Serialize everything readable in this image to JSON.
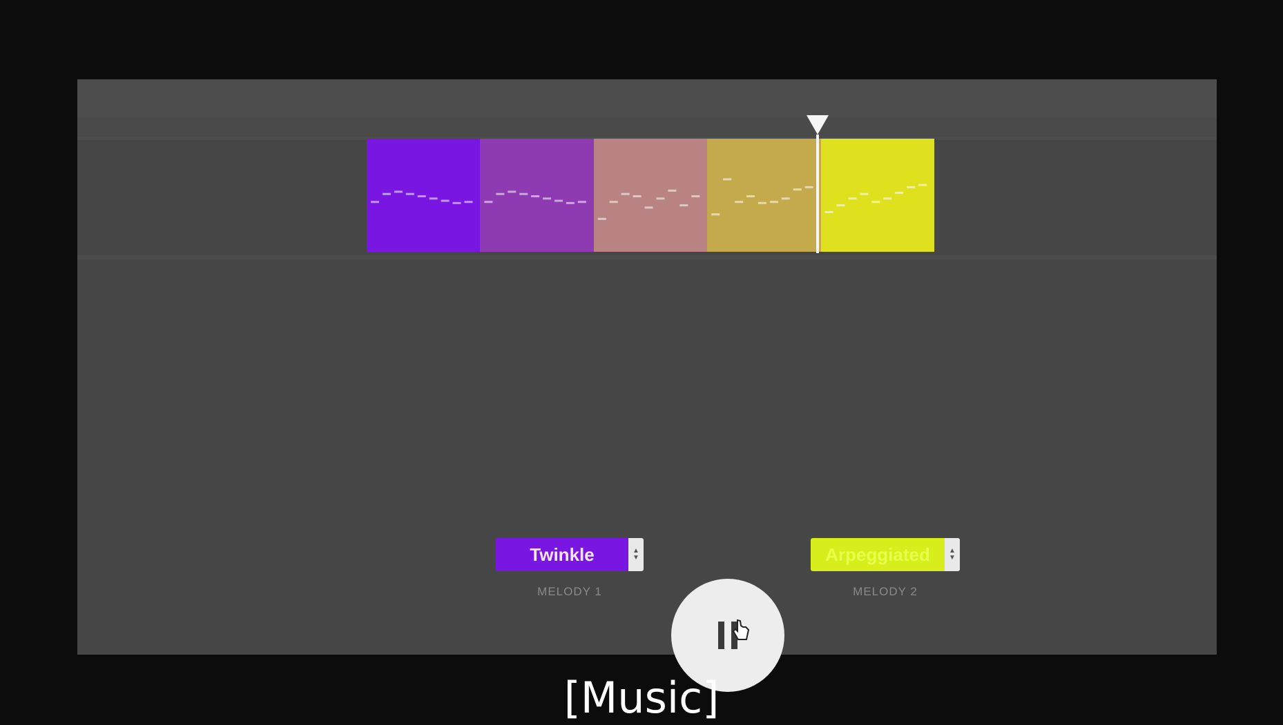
{
  "timeline": {
    "segments": [
      {
        "color": "#7a16e2"
      },
      {
        "color": "#8e3ab2"
      },
      {
        "color": "#b98383"
      },
      {
        "color": "#c5aa4d"
      },
      {
        "color": "#dfe11e"
      }
    ],
    "playhead_progress": 0.795
  },
  "controls": {
    "melody1": {
      "value": "Twinkle",
      "caption": "MELODY 1",
      "bg": "#7a16e2",
      "fg": "#f2e6ff"
    },
    "melody2": {
      "value": "Arpeggiated",
      "caption": "MELODY 2",
      "bg": "#d7ed1c",
      "fg": "#e8ff4a"
    },
    "play_button_icon": "pause-icon"
  },
  "subtitle": "[Music]"
}
